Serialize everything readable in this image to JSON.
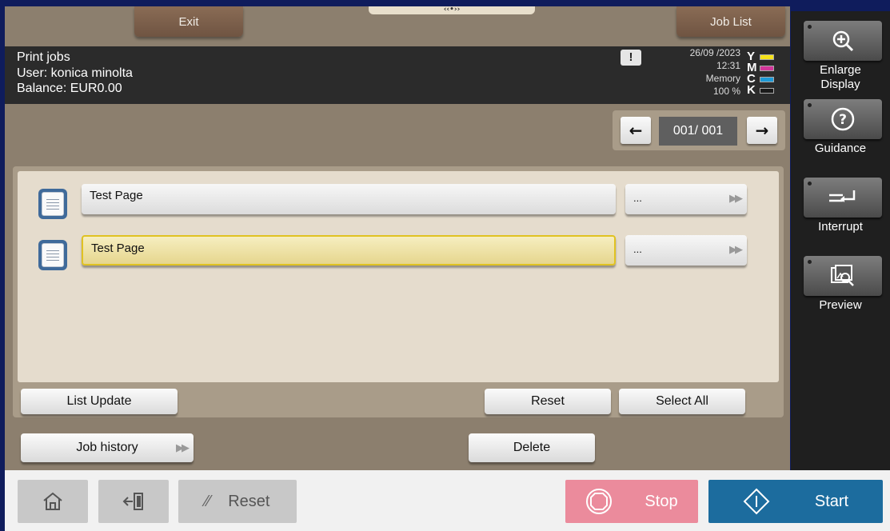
{
  "topbar": {
    "exit_label": "Exit",
    "job_list_label": "Job List",
    "handle_label": "‹‹•››"
  },
  "info": {
    "line1": "Print jobs",
    "line2": "User: konica minolta",
    "line3": "Balance: EUR0.00",
    "warning_symbol": "!",
    "date": "26/09 /2023",
    "time": "12:31",
    "memory_label": "Memory",
    "memory_value": "100 %",
    "toner": [
      {
        "letter": "Y",
        "color": "#f5e21a"
      },
      {
        "letter": "M",
        "color": "#d2369a"
      },
      {
        "letter": "C",
        "color": "#1e9ad6"
      },
      {
        "letter": "K",
        "color": "#1a1a1a"
      }
    ]
  },
  "pager": {
    "prev_symbol": "←",
    "next_symbol": "→",
    "page_text": "001/  001"
  },
  "jobs": [
    {
      "name": "Test Page",
      "more": "...",
      "selected": false
    },
    {
      "name": "Test Page",
      "more": "...",
      "selected": true
    }
  ],
  "actions": {
    "list_update": "List Update",
    "reset": "Reset",
    "select_all": "Select All",
    "job_history": "Job history",
    "delete": "Delete"
  },
  "side": {
    "enlarge_line1": "Enlarge",
    "enlarge_line2": "Display",
    "guidance": "Guidance",
    "interrupt": "Interrupt",
    "preview": "Preview"
  },
  "bottom": {
    "reset": "Reset",
    "stop": "Stop",
    "start": "Start"
  },
  "colors": {
    "selected_row_border": "#e0c222",
    "stop": "#eb8b9c",
    "start": "#1c6c9e"
  }
}
